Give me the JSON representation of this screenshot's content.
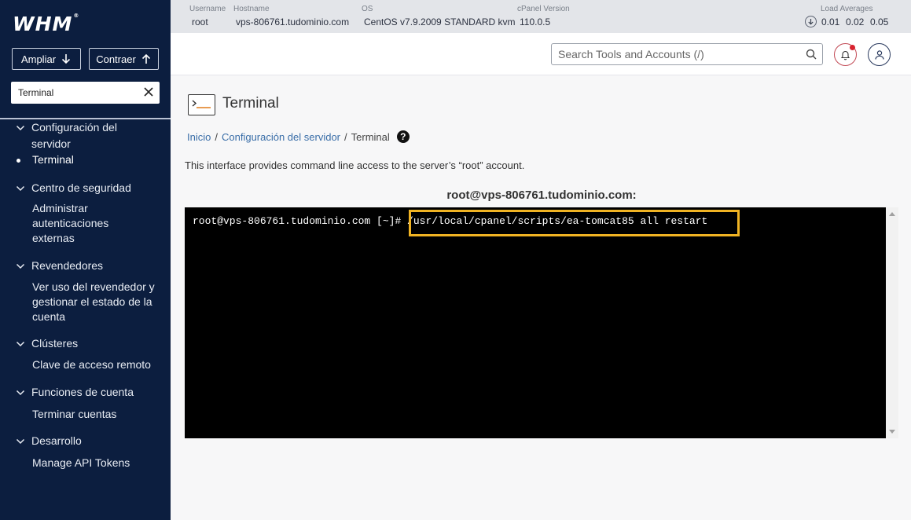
{
  "app": {
    "logo": "WHM",
    "logo_mark": "®"
  },
  "sidebar": {
    "expand_label": "Ampliar",
    "collapse_label": "Contraer",
    "search_value": "Terminal",
    "groups": [
      {
        "title_line1": "Configuración del",
        "title_line2": "servidor",
        "items": [
          "Terminal"
        ]
      },
      {
        "title": "Centro de seguridad",
        "items": [
          "Administrar",
          "autenticaciones",
          "externas"
        ]
      },
      {
        "title": "Revendedores",
        "items": [
          "Ver uso del revendedor y",
          "gestionar el estado de la",
          "cuenta"
        ]
      },
      {
        "title": "Clústeres",
        "items": [
          "Clave de acceso remoto"
        ]
      },
      {
        "title": "Funciones de cuenta",
        "items": [
          "Terminar cuentas"
        ]
      },
      {
        "title": "Desarrollo",
        "items": [
          "Manage API Tokens"
        ]
      }
    ]
  },
  "server_info": {
    "username_label": "Username",
    "username": "root",
    "hostname_label": "Hostname",
    "hostname": "vps-806761.tudominio.com",
    "os_label": "OS",
    "os": "CentOS v7.9.2009 STANDARD kvm",
    "cpanel_label": "cPanel Version",
    "cpanel": "110.0.5",
    "load_label": "Load Averages",
    "load": [
      "0.01",
      "0.02",
      "0.05"
    ]
  },
  "header": {
    "search_placeholder": "Search Tools and Accounts (/)"
  },
  "page": {
    "title": "Terminal",
    "breadcrumb": [
      "Inicio",
      "Configuración del servidor",
      "Terminal"
    ],
    "help": "?",
    "description": "This interface provides command line access to the server’s “root” account."
  },
  "terminal": {
    "title": "root@vps-806761.tudominio.com:",
    "prompt": "root@vps-806761.tudominio.com [~]# ",
    "command": "/usr/local/cpanel/scripts/ea-tomcat85 all restart"
  },
  "colors": {
    "sidebar_bg": "#0c1e3f",
    "highlight": "#f0b323",
    "link": "#3a6ea8"
  }
}
